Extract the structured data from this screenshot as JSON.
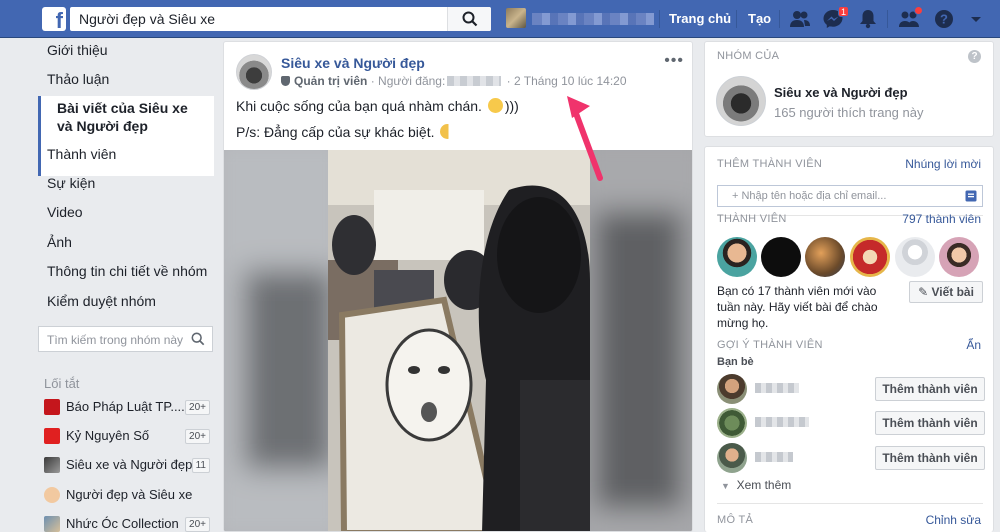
{
  "topbar": {
    "search_value": "Người đẹp và Siêu xe",
    "home": "Trang chủ",
    "create": "Tạo",
    "messenger_badge": "1",
    "colors": {
      "bar": "#4267b2",
      "badge": "#fa3e3e"
    }
  },
  "left_nav": {
    "items": [
      "Giới thiệu",
      "Thảo luận",
      "Thành viên",
      "Sự kiện",
      "Video",
      "Ảnh",
      "Thông tin chi tiết về nhóm",
      "Kiểm duyệt nhóm"
    ],
    "active": "Bài viết của Siêu xe và Người đẹp",
    "search_placeholder": "Tìm kiếm trong nhóm này",
    "shortcuts_title": "Lối tắt",
    "shortcuts": [
      {
        "label": "Báo Pháp Luật TP....",
        "count": "20+",
        "icon": "plo-logo"
      },
      {
        "label": "Kỷ Nguyên Số",
        "count": "20+",
        "icon": "ky-nguyen-so-logo"
      },
      {
        "label": "Siêu xe và Người đẹp",
        "count": "11",
        "icon": "motorbike-thumb"
      },
      {
        "label": "Người đẹp và Siêu xe",
        "count": "",
        "icon": "hand-emoji"
      },
      {
        "label": "Nhức Óc Collection",
        "count": "20+",
        "icon": "group-thumb"
      }
    ]
  },
  "post": {
    "group_name": "Siêu xe và Người đẹp",
    "role": "Quản trị viên",
    "poster_label": "· Người đăng:",
    "timestamp": "· 2 Tháng 10 lúc 14:20",
    "text1": "Khi cuộc sống của bạn quá nhàm chán.",
    "text1_suffix": ")))",
    "text2": "P/s: Đẳng cấp của sự khác biệt.",
    "more": "•••"
  },
  "right": {
    "group_card": {
      "title": "NHÓM CỦA",
      "name": "Siêu xe và Người đẹp",
      "likes": "165 người thích trang này",
      "help": "?"
    },
    "add_member": {
      "title": "THÊM THÀNH VIÊN",
      "link": "Nhúng lời mời",
      "placeholder": "+ Nhập tên hoặc địa chỉ email..."
    },
    "members": {
      "title": "THÀNH VIÊN",
      "count": "797 thành viên",
      "new_text": "Bạn có 17 thành viên mới vào tuần này. Hãy viết bài để chào mừng họ.",
      "write_button": "Viết bài"
    },
    "suggest": {
      "title": "GỢI Ý THÀNH VIÊN",
      "hide": "Ẩn",
      "friends": "Bạn bè",
      "add_button": "Thêm thành viên",
      "see_more": "Xem thêm"
    },
    "description": {
      "title": "MÔ TẢ",
      "edit": "Chỉnh sửa"
    }
  }
}
